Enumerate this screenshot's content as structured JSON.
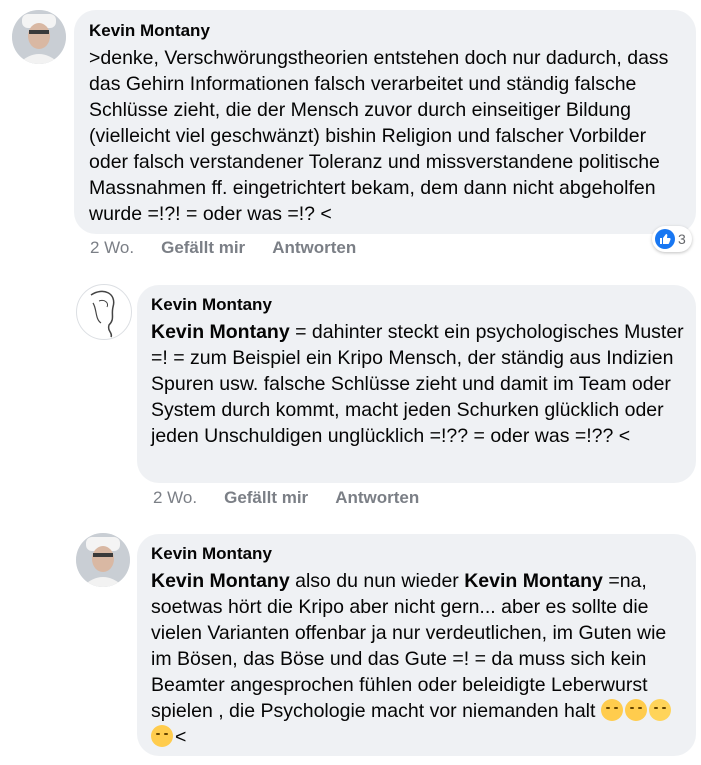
{
  "comments": [
    {
      "author": "Kevin Montany",
      "text": ">denke, Verschwörungstheorien entstehen doch nur dadurch, dass das Gehirn Informationen falsch verarbeitet und ständig falsche Schlüsse zieht, die der Mensch zuvor durch einseitiger Bildung (vielleicht viel geschwänzt) bishin Religion und falscher Vorbilder oder falsch verstandener Toleranz und missverstandene  politische Massnahmen ff. eingetrichtert bekam, dem dann  nicht abgeholfen wurde =!?! = oder was =!? <",
      "time": "2 Wo.",
      "like_label": "Gefällt mir",
      "reply_label": "Antworten",
      "reaction_count": "3"
    },
    {
      "author": "Kevin Montany",
      "mention": "Kevin Montany",
      "text": " = dahinter steckt ein psychologisches Muster =! = zum Beispiel ein Kripo Mensch, der ständig aus Indizien Spuren usw. falsche Schlüsse zieht und damit  im Team oder System durch kommt, macht jeden Schurken glücklich oder jeden Unschuldigen unglücklich =!?? = oder was =!?? <",
      "time": "2 Wo.",
      "like_label": "Gefällt mir",
      "reply_label": "Antworten"
    },
    {
      "author": "Kevin Montany",
      "mention1": "Kevin Montany",
      "text1": " also du nun wieder ",
      "mention2": "Kevin Montany",
      "text2": " =na, soetwas hört die Kripo aber nicht gern... aber es sollte die vielen Varianten offenbar ja nur verdeutlichen, im Guten wie im Bösen, das Böse und das Gute =! = da muss sich kein Beamter angesprochen fühlen oder beleidigte Leberwurst spielen , die Psychologie macht vor niemanden halt ",
      "emojis": [
        "relieved-face-icon",
        "worried-face-icon",
        "tears-of-joy-icon",
        "upside-down-face-icon"
      ],
      "tail": "<"
    }
  ]
}
